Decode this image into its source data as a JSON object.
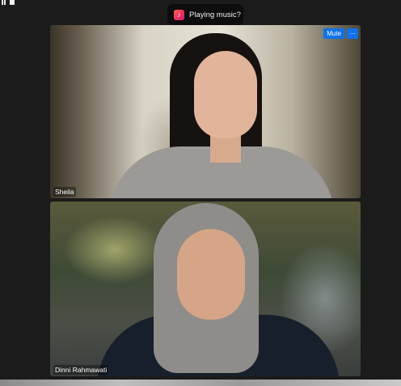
{
  "notification": {
    "icon": "music-note-icon",
    "text": "Playing music?"
  },
  "participants": [
    {
      "name": "Sheila",
      "mute_label": "Mute",
      "more_label": "···"
    },
    {
      "name": "Dinni Rahmawati"
    }
  ],
  "colors": {
    "accent": "#0e72ed",
    "background": "#1b1b1b"
  }
}
